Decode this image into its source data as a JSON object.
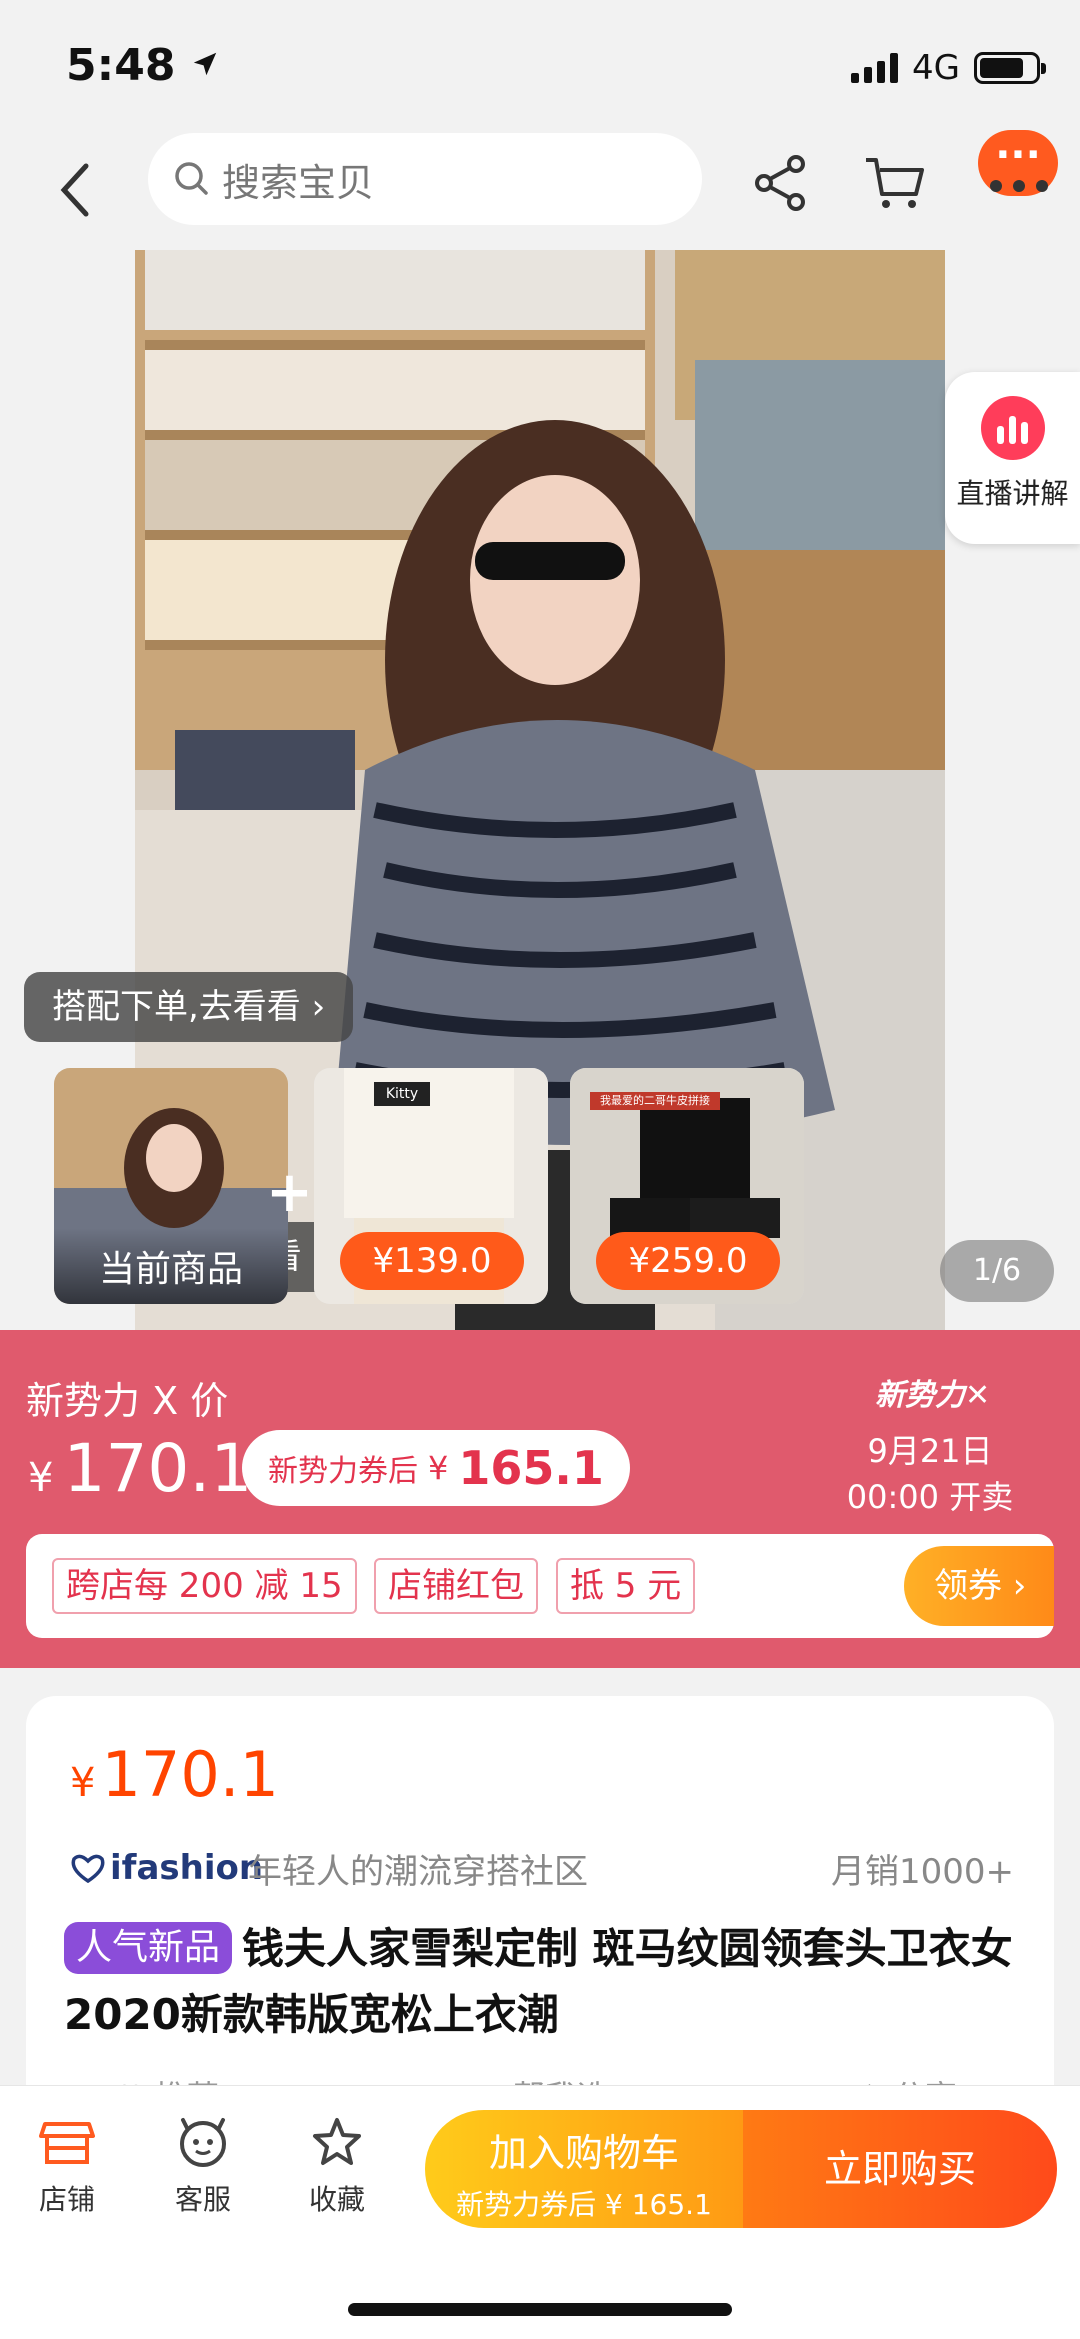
{
  "status": {
    "time": "5:48",
    "network": "4G"
  },
  "nav": {
    "search_placeholder": "搜索宝贝",
    "more_badge": "···"
  },
  "hero": {
    "live_label": "直播讲解",
    "combo_tag": "搭配下单,去看看 ›",
    "thumbs": [
      {
        "label": "当前商品"
      },
      {
        "price": "¥139.0"
      },
      {
        "price": "¥259.0"
      }
    ],
    "thumb2_caption": "Kitty",
    "thumb3_caption": "我最爱的二哥牛皮拼接",
    "pager": "1/6"
  },
  "promo": {
    "title": "新势力 X 价",
    "price_currency": "¥",
    "price_value": "170.1",
    "coupon_label": "新势力券后",
    "coupon_currency": "¥",
    "coupon_value": "165.1",
    "logo": "新势力✕",
    "date": "9月21日",
    "time": "00:00 开卖",
    "tags": [
      "跨店每 200 减 15",
      "店铺红包",
      "抵 5 元"
    ],
    "claim_button": "领券 ›"
  },
  "info": {
    "price_currency": "¥",
    "price_value": "170.1",
    "ifashion": "ifashion",
    "slogan": "年轻人的潮流穿搭社区",
    "sales": "月销1000+",
    "badge": "人气新品",
    "title": "钱夫人家雪梨定制 斑马纹圆领套头卫衣女2020新款韩版宽松上衣潮",
    "cut_row": [
      "推荐",
      "帮我选",
      "分享"
    ]
  },
  "bottom": {
    "store": "店铺",
    "service": "客服",
    "favorite": "收藏",
    "cart_label": "加入购物车",
    "cart_sub": "新势力券后 ¥ 165.1",
    "buy_label": "立即购买"
  },
  "colors": {
    "accent": "#ff4400",
    "promo_bg": "#e05a6d",
    "badge": "#8b4dd9"
  }
}
